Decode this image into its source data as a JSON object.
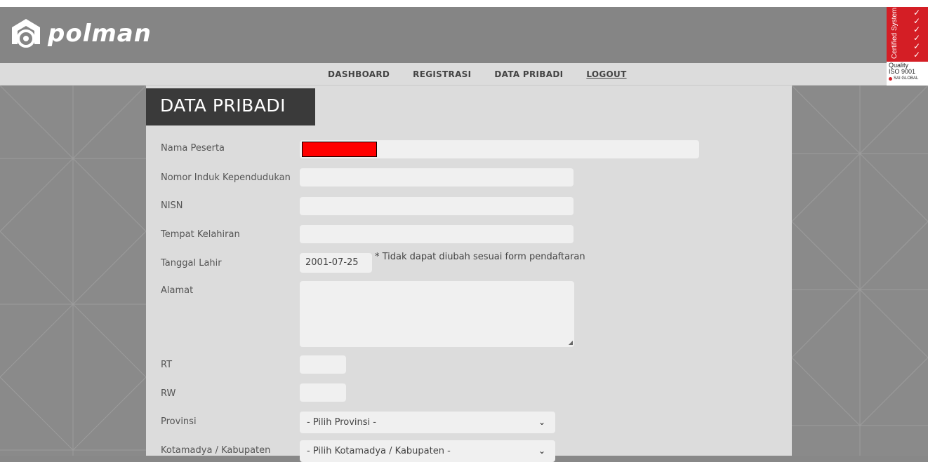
{
  "header": {
    "logo_text": "polman",
    "nav": [
      "DASHBOARD",
      "REGISTRASI",
      "DATA PRIBADI",
      "LOGOUT"
    ]
  },
  "badge": {
    "vertical_text": "Certified System",
    "line1": "Quality",
    "line2": "ISO 9001",
    "brand": "SAI GLOBAL"
  },
  "page": {
    "title": "DATA PRIBADI"
  },
  "form": {
    "nama_label": "Nama Peserta",
    "nik_label": "Nomor Induk Kependudukan",
    "nisn_label": "NISN",
    "tempat_label": "Tempat Kelahiran",
    "tanggal_label": "Tanggal Lahir",
    "tanggal_value": "2001-07-25",
    "tanggal_note": "* Tidak dapat diubah sesuai form pendaftaran",
    "alamat_label": "Alamat",
    "rt_label": "RT",
    "rw_label": "RW",
    "provinsi_label": "Provinsi",
    "provinsi_value": "- Pilih Provinsi -",
    "kota_label": "Kotamadya / Kabupaten",
    "kota_value": "- Pilih Kotamadya / Kabupaten -"
  }
}
